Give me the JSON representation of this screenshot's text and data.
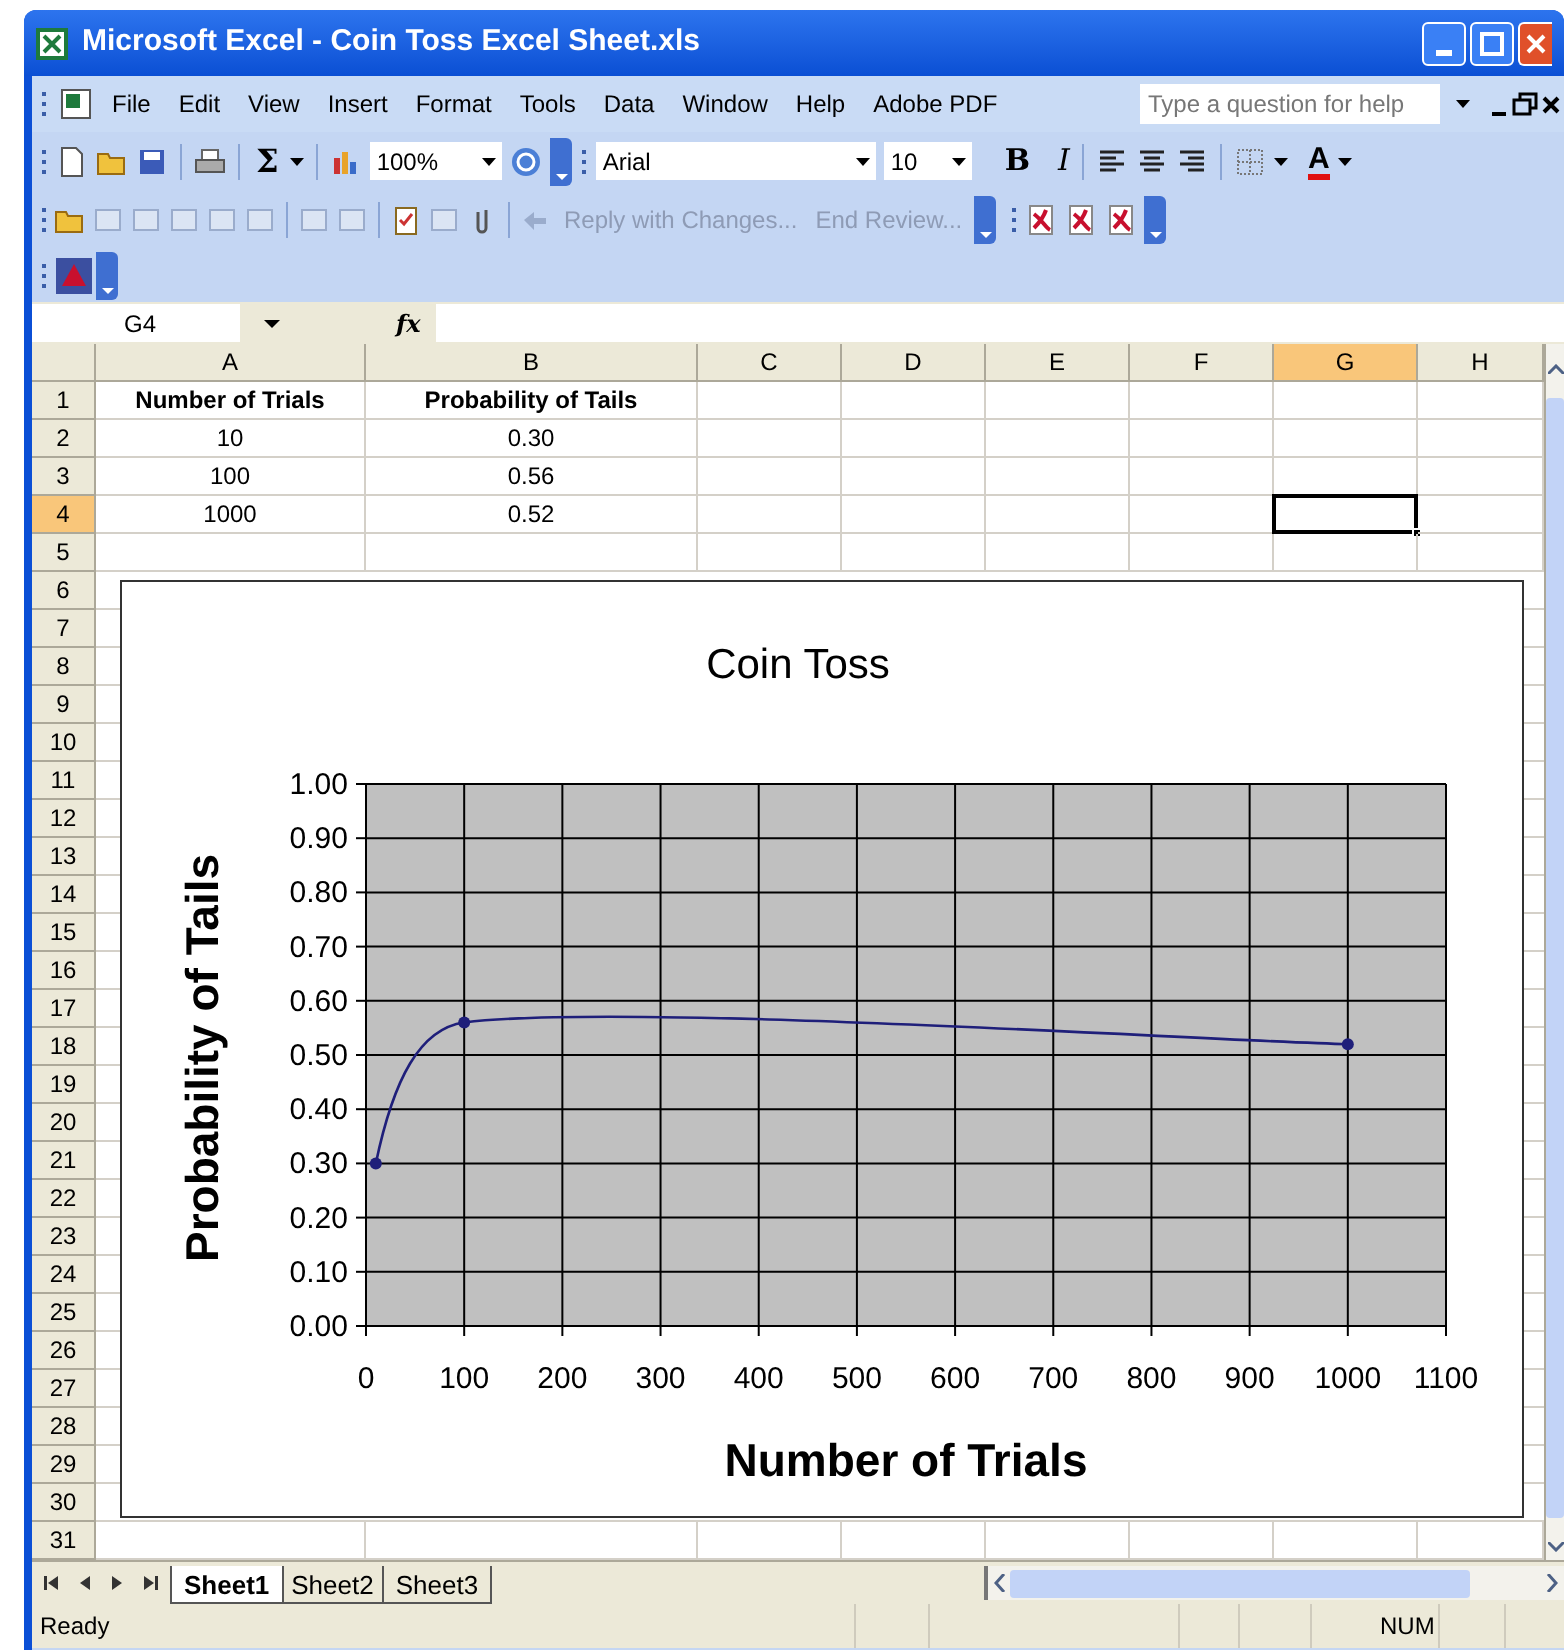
{
  "window": {
    "title": "Microsoft Excel - Coin Toss Excel Sheet.xls"
  },
  "menu_bar": {
    "items": [
      "File",
      "Edit",
      "View",
      "Insert",
      "Format",
      "Tools",
      "Data",
      "Window",
      "Help",
      "Adobe PDF"
    ],
    "help_field": {
      "placeholder": "Type a question for help"
    }
  },
  "standard_toolbar": {
    "autosum": "Σ",
    "zoom": "100%",
    "font": "Arial",
    "font_size": "10",
    "bold": "B",
    "italic": "I",
    "font_color": "A"
  },
  "reviewing_toolbar": {
    "buttons": [
      {
        "label": "Reply with Changes...",
        "disabled": true
      },
      {
        "label": "End Review...",
        "disabled": true
      }
    ]
  },
  "formula_bar": {
    "name_box": "G4",
    "function_symbol": "fx"
  },
  "sheet": {
    "columns": [
      {
        "label": "A",
        "selected": false
      },
      {
        "label": "B",
        "selected": false
      },
      {
        "label": "C",
        "selected": false
      },
      {
        "label": "D",
        "selected": false
      },
      {
        "label": "E",
        "selected": false
      },
      {
        "label": "F",
        "selected": false
      },
      {
        "label": "G",
        "selected": true
      },
      {
        "label": "H",
        "selected": false
      }
    ],
    "rows": [
      {
        "number": "1",
        "selected": false,
        "kind": "header",
        "cells": [
          "Number of Trials",
          "Probability of Tails"
        ]
      },
      {
        "number": "2",
        "selected": false,
        "kind": "data",
        "cells": [
          "10",
          "0.30"
        ]
      },
      {
        "number": "3",
        "selected": false,
        "kind": "data",
        "cells": [
          "100",
          "0.56"
        ]
      },
      {
        "number": "4",
        "selected": true,
        "kind": "data",
        "cells": [
          "1000",
          "0.52"
        ]
      },
      {
        "number": "5",
        "selected": false
      },
      {
        "number": "6",
        "selected": false
      },
      {
        "number": "7",
        "selected": false
      },
      {
        "number": "8",
        "selected": false
      },
      {
        "number": "9",
        "selected": false
      },
      {
        "number": "10",
        "selected": false
      },
      {
        "number": "11",
        "selected": false
      },
      {
        "number": "12",
        "selected": false
      },
      {
        "number": "13",
        "selected": false
      },
      {
        "number": "14",
        "selected": false
      },
      {
        "number": "15",
        "selected": false
      },
      {
        "number": "16",
        "selected": false
      },
      {
        "number": "17",
        "selected": false
      },
      {
        "number": "18",
        "selected": false
      },
      {
        "number": "19",
        "selected": false
      },
      {
        "number": "20",
        "selected": false
      },
      {
        "number": "21",
        "selected": false
      },
      {
        "number": "22",
        "selected": false
      },
      {
        "number": "23",
        "selected": false
      },
      {
        "number": "24",
        "selected": false
      },
      {
        "number": "25",
        "selected": false
      },
      {
        "number": "26",
        "selected": false
      },
      {
        "number": "27",
        "selected": false
      },
      {
        "number": "28",
        "selected": false
      },
      {
        "number": "29",
        "selected": false
      },
      {
        "number": "30",
        "selected": false
      },
      {
        "number": "31",
        "selected": false
      }
    ]
  },
  "chart": {
    "chart_data": {
      "type": "line",
      "title": "Coin Toss",
      "xlabel": "Number of Trials",
      "ylabel": "Probability of Tails",
      "x": [
        10,
        100,
        1000
      ],
      "series": [
        {
          "color": "#1f1f7a",
          "marker": "circle",
          "values": [
            0.3,
            0.56,
            0.52
          ]
        }
      ],
      "grid": true,
      "xlim": [
        0,
        1100
      ],
      "ylim": [
        0,
        1
      ],
      "xticks": [
        0,
        100,
        200,
        300,
        400,
        500,
        600,
        700,
        800,
        900,
        1000,
        1100
      ],
      "yticks": [
        {
          "value": 0,
          "label": "0.00"
        },
        {
          "value": 0.1,
          "label": "0.10"
        },
        {
          "value": 0.2,
          "label": "0.20"
        },
        {
          "value": 0.3,
          "label": "0.30"
        },
        {
          "value": 0.4,
          "label": "0.40"
        },
        {
          "value": 0.5,
          "label": "0.50"
        },
        {
          "value": 0.6,
          "label": "0.60"
        },
        {
          "value": 0.7,
          "label": "0.70"
        },
        {
          "value": 0.8,
          "label": "0.80"
        },
        {
          "value": 0.9,
          "label": "0.90"
        },
        {
          "value": 1,
          "label": "1.00"
        }
      ]
    }
  },
  "sheet_tabs": [
    {
      "label": "Sheet1",
      "selected": true
    },
    {
      "label": "Sheet2",
      "selected": false
    },
    {
      "label": "Sheet3",
      "selected": false
    }
  ],
  "status_bar": {
    "text": "Ready",
    "indicator": "NUM"
  }
}
